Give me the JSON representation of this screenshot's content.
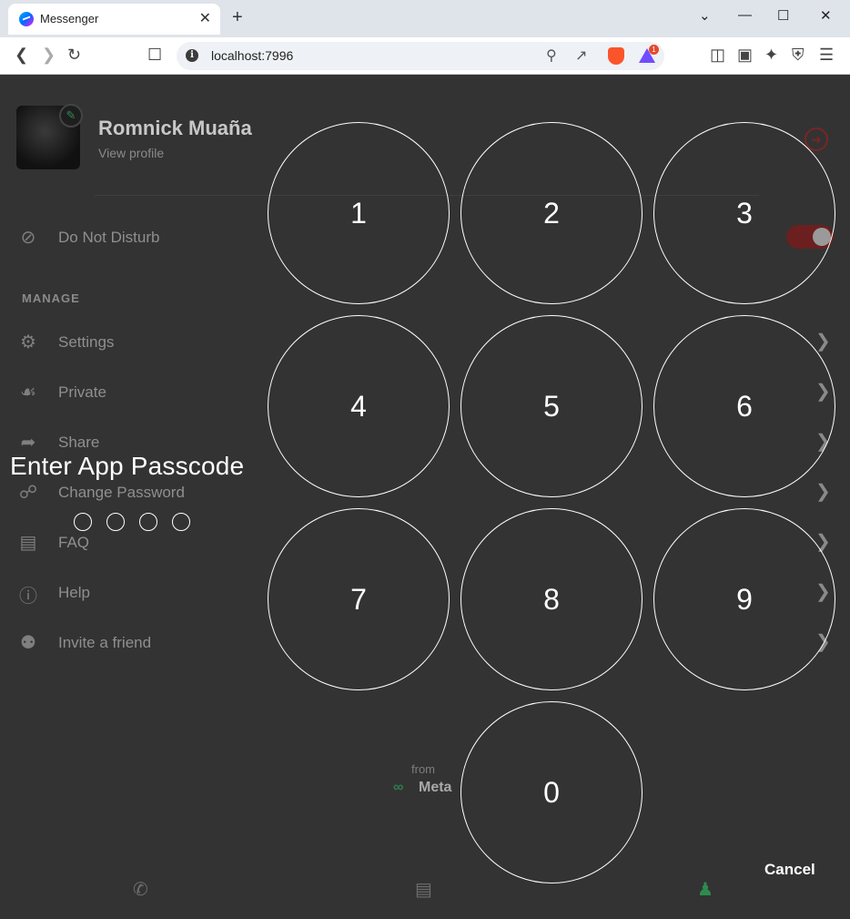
{
  "browser": {
    "tab_title": "Messenger",
    "tab_close": "✕",
    "new_tab": "+",
    "url": "localhost:7996",
    "brave_badge_count": "1",
    "window_controls": {
      "list": "⌄",
      "minimize": "—",
      "maximize": "☐",
      "close": "✕"
    }
  },
  "profile": {
    "name": "Romnick Muaña",
    "subtitle": "View profile"
  },
  "menu": {
    "do_not_disturb": "Do Not Disturb",
    "section_manage": "MANAGE",
    "items": [
      {
        "label": "Settings",
        "icon": "gear-icon"
      },
      {
        "label": "Private",
        "icon": "incognito-icon"
      },
      {
        "label": "Share",
        "icon": "share-icon"
      },
      {
        "label": "Change Password",
        "icon": "lock-icon"
      },
      {
        "label": "FAQ",
        "icon": "chat-bubbles-icon"
      },
      {
        "label": "Help",
        "icon": "help-icon"
      },
      {
        "label": "Invite a friend",
        "icon": "people-icon"
      }
    ]
  },
  "footer": {
    "from": "from",
    "brand": "Meta"
  },
  "passcode": {
    "title": "Enter App Passcode",
    "keys": [
      "1",
      "2",
      "3",
      "4",
      "5",
      "6",
      "7",
      "8",
      "9",
      "0"
    ],
    "cancel": "Cancel",
    "entered_count": 0,
    "length": 4
  },
  "colors": {
    "overlay_bg": "#333333",
    "accent_green": "#2e8b4f",
    "logout_red": "#7a2525"
  }
}
